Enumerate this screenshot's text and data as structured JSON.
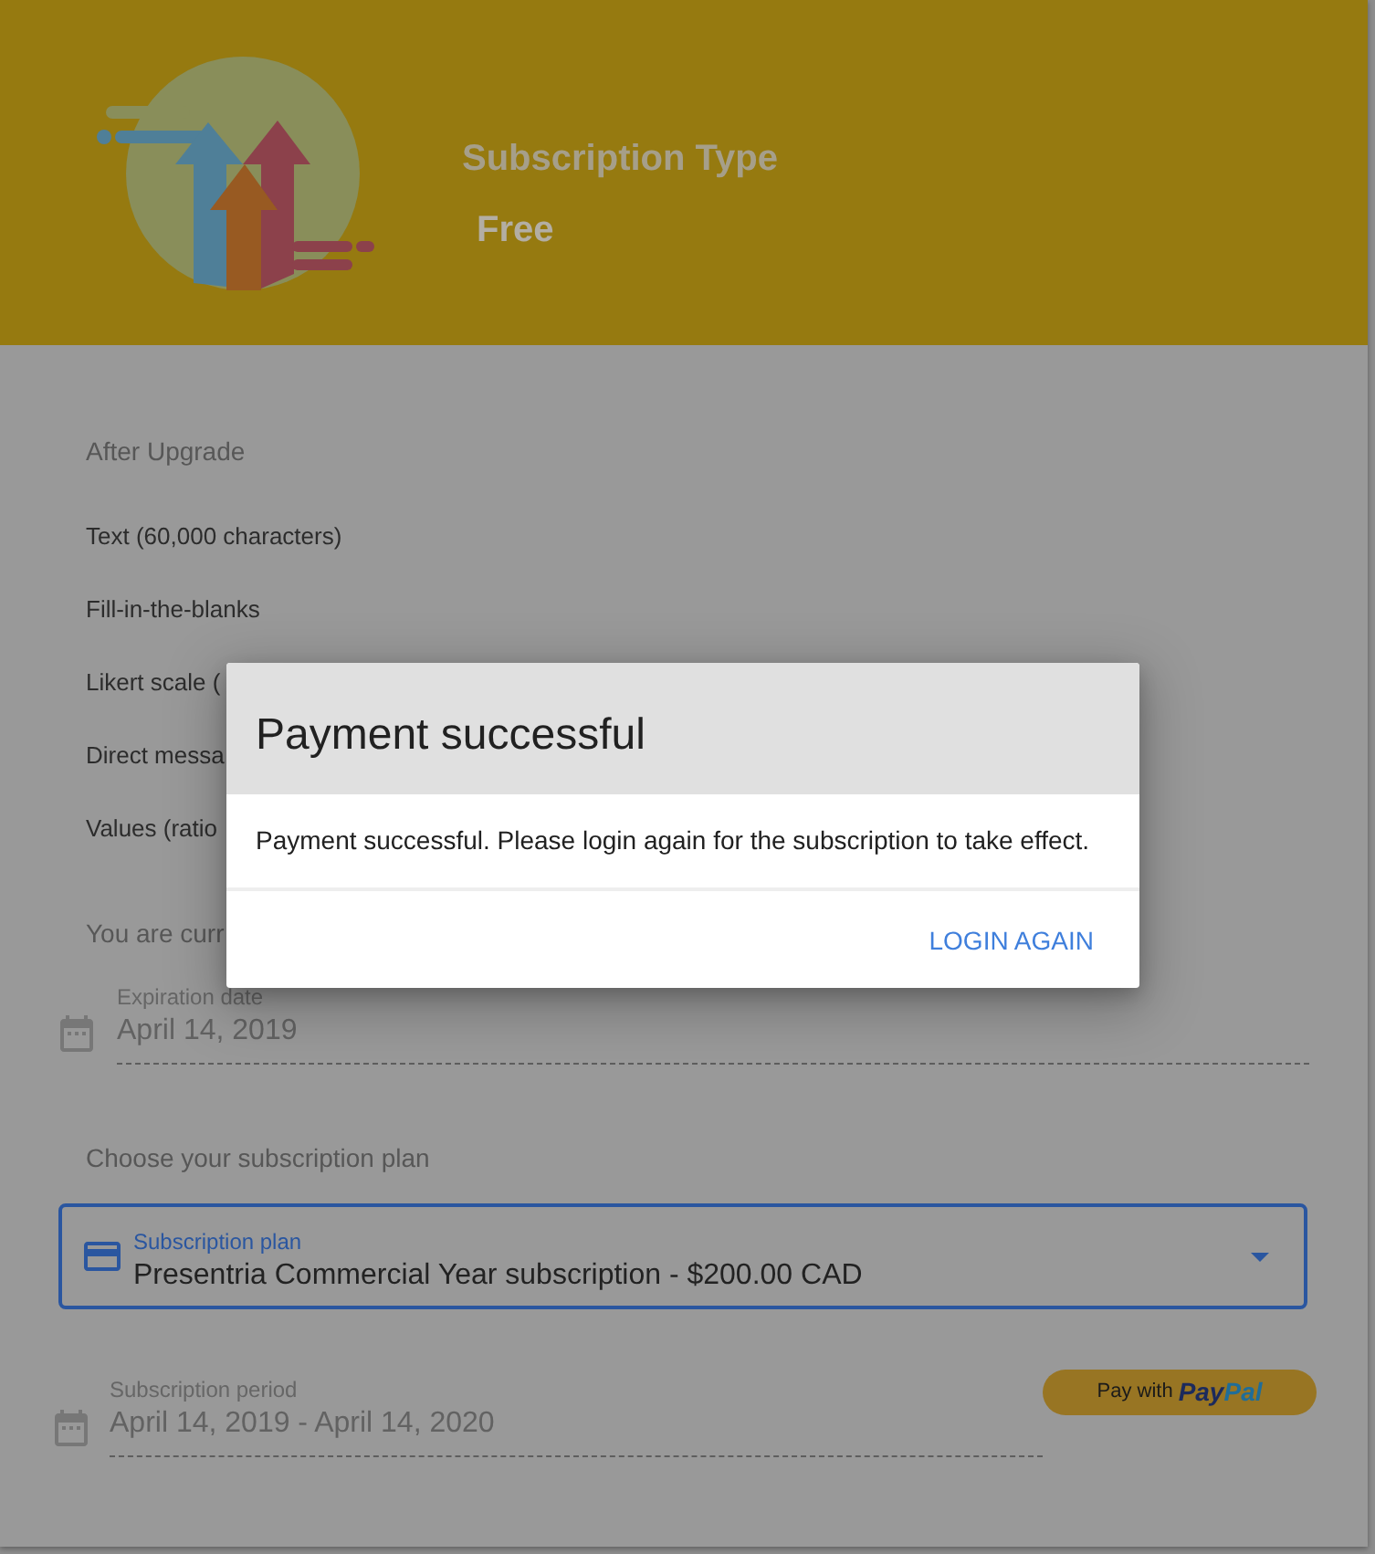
{
  "header": {
    "title": "Subscription Type",
    "value": "Free"
  },
  "features": {
    "heading": "After Upgrade",
    "items": [
      "Text (60,000 characters)",
      "Fill-in-the-blanks",
      "Likert scale (",
      "Direct messa",
      "Values (ratio"
    ]
  },
  "current_note": "You are curr",
  "expiration_field": {
    "label": "Expiration date",
    "value": "April 14, 2019",
    "disabled": true
  },
  "plan_section": {
    "heading": "Choose your subscription plan",
    "select": {
      "label": "Subscription plan",
      "value": "Presentria Commercial Year subscription - $200.00 CAD",
      "focused": true
    }
  },
  "period_field": {
    "label": "Subscription period",
    "value": "April 14, 2019 - April 14, 2020",
    "disabled": true
  },
  "paypal_button": {
    "label": "Pay with",
    "brand": [
      "Pay",
      "Pal"
    ]
  },
  "dialog": {
    "title": "Payment successful",
    "message": "Payment successful. Please login again for the subscription to take effect.",
    "actions": [
      {
        "label": "LOGIN AGAIN"
      }
    ]
  }
}
